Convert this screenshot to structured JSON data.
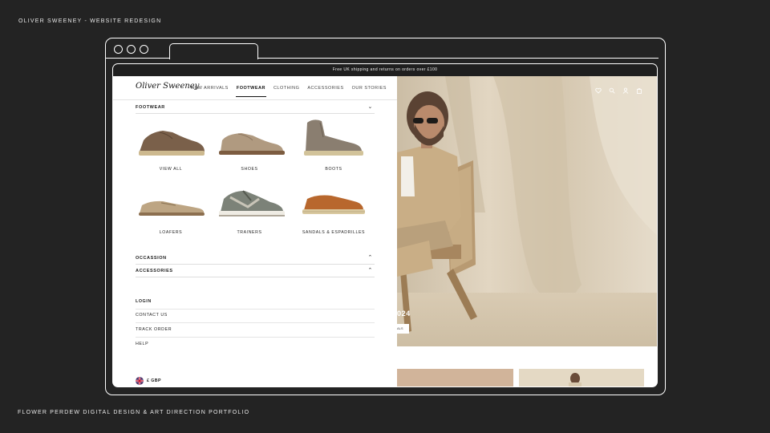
{
  "slide": {
    "title": "OLIVER SWEENEY - WEBSITE REDESIGN",
    "footer": "FLOWER PERDEW DIGITAL DESIGN & ART DIRECTION PORTFOLIO"
  },
  "site": {
    "promo": "Free UK shipping and returns on orders over £100",
    "brand": "Oliver Sweeney",
    "nav": [
      "NEW ARRIVALS",
      "FOOTWEAR",
      "CLOTHING",
      "ACCESSORIES",
      "OUR STORIES"
    ],
    "active_nav": "FOOTWEAR",
    "header_icons": [
      "heart-icon",
      "search-icon",
      "account-icon",
      "bag-icon"
    ],
    "menu": {
      "open_section": "FOOTWEAR",
      "categories": [
        {
          "label": "VIEW ALL",
          "icon": "view-all-shoe-icon"
        },
        {
          "label": "SHOES",
          "icon": "shoes-icon"
        },
        {
          "label": "BOOTS",
          "icon": "boots-icon"
        },
        {
          "label": "LOAFERS",
          "icon": "loafers-icon"
        },
        {
          "label": "TRAINERS",
          "icon": "trainers-icon"
        },
        {
          "label": "SANDALS & ESPADRILLES",
          "icon": "espadrilles-icon"
        }
      ],
      "collapsed_sections": [
        "OCCASSION",
        "ACCESSORIES"
      ],
      "account_links": [
        "LOGIN",
        "CONTACT US",
        "TRACK ORDER",
        "HELP"
      ],
      "currency": "£ GBP"
    },
    "hero": {
      "year_text": "024",
      "button_text": "ALS"
    },
    "colors": {
      "background": "#232323",
      "promo_bar": "#1f1f1f",
      "hero_backdrop": "#d9cdb8"
    }
  }
}
